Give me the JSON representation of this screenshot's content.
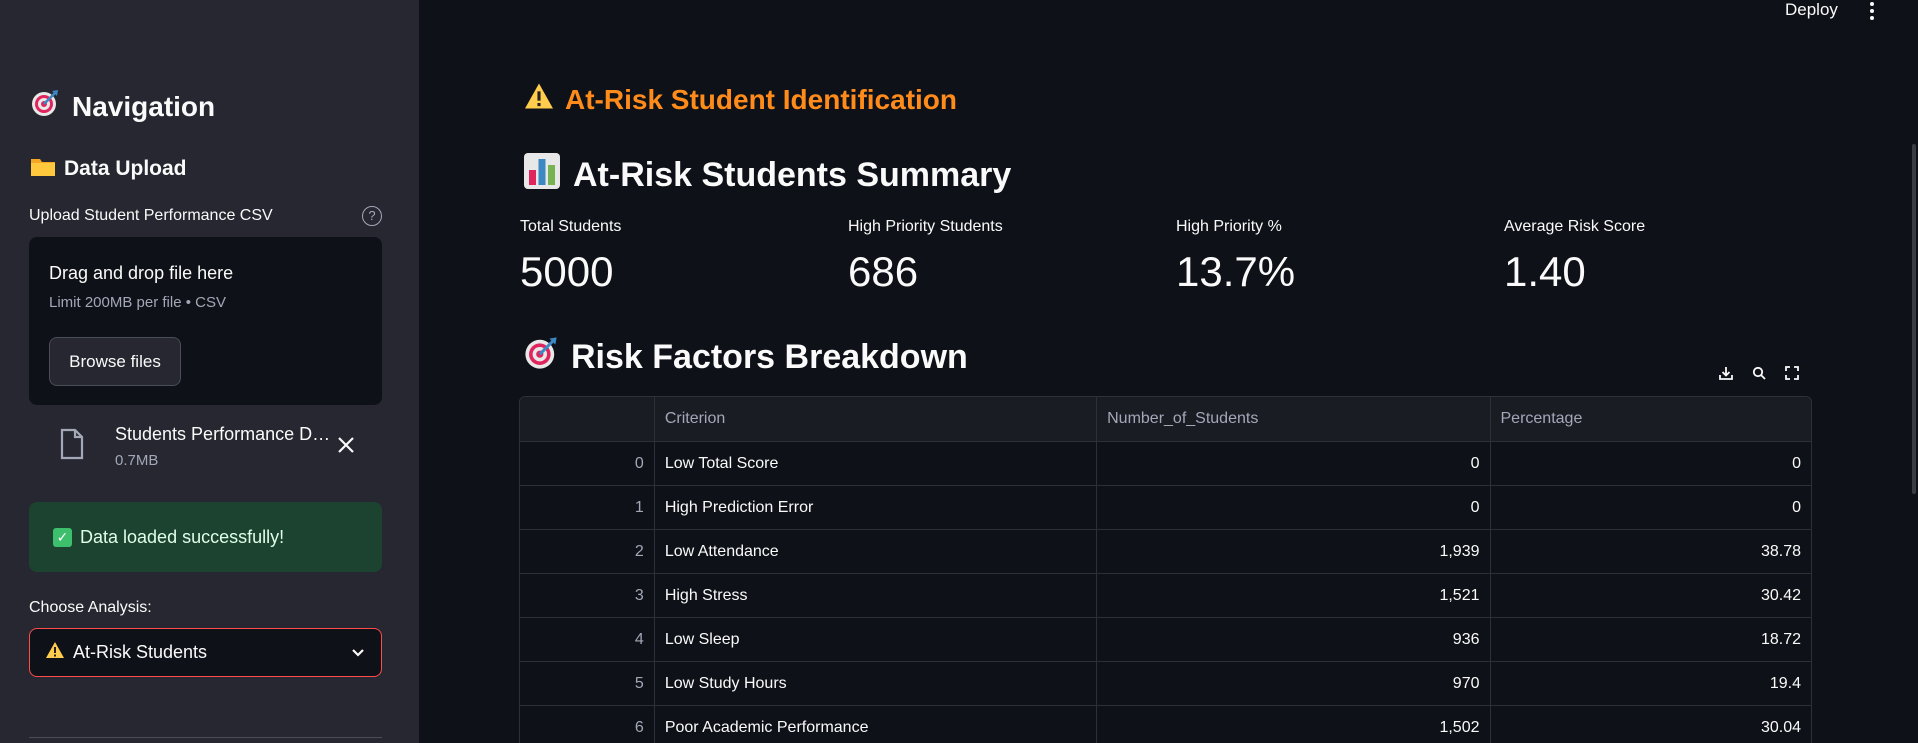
{
  "sidebar": {
    "nav_title": "Navigation",
    "section_title": "Data Upload",
    "upload_label": "Upload Student Performance CSV",
    "help_glyph": "?",
    "dropzone_title": "Drag and drop file here",
    "dropzone_limit": "Limit 200MB per file • CSV",
    "browse_label": "Browse files",
    "file_name": "Students Performance Dataset.csv",
    "file_size": "0.7MB",
    "success_message": "Data loaded successfully!",
    "choose_label": "Choose Analysis:",
    "selected_analysis": "At-Risk Students"
  },
  "header": {
    "deploy_label": "Deploy"
  },
  "main": {
    "page_title": "At-Risk Student Identification",
    "summary_heading": "At-Risk Students Summary",
    "metrics": [
      {
        "label": "Total Students",
        "value": "5000"
      },
      {
        "label": "High Priority Students",
        "value": "686"
      },
      {
        "label": "High Priority %",
        "value": "13.7%"
      },
      {
        "label": "Average Risk Score",
        "value": "1.40"
      }
    ],
    "risk_heading": "Risk Factors Breakdown",
    "table": {
      "columns": [
        "",
        "Criterion",
        "Number_of_Students",
        "Percentage"
      ],
      "rows": [
        [
          "0",
          "Low Total Score",
          "0",
          "0"
        ],
        [
          "1",
          "High Prediction Error",
          "0",
          "0"
        ],
        [
          "2",
          "Low Attendance",
          "1,939",
          "38.78"
        ],
        [
          "3",
          "High Stress",
          "1,521",
          "30.42"
        ],
        [
          "4",
          "Low Sleep",
          "936",
          "18.72"
        ],
        [
          "5",
          "Low Study Hours",
          "970",
          "19.4"
        ],
        [
          "6",
          "Poor Academic Performance",
          "1,502",
          "30.04"
        ]
      ]
    }
  },
  "icons": {
    "nav": "target-icon",
    "section": "folder-icon",
    "warning": "warning-icon",
    "summary": "bar-chart-icon",
    "risk": "target-icon"
  },
  "colors": {
    "accent_orange": "#ff8c1a",
    "success_bg": "#1c4330",
    "select_border": "#ff4b4b"
  }
}
